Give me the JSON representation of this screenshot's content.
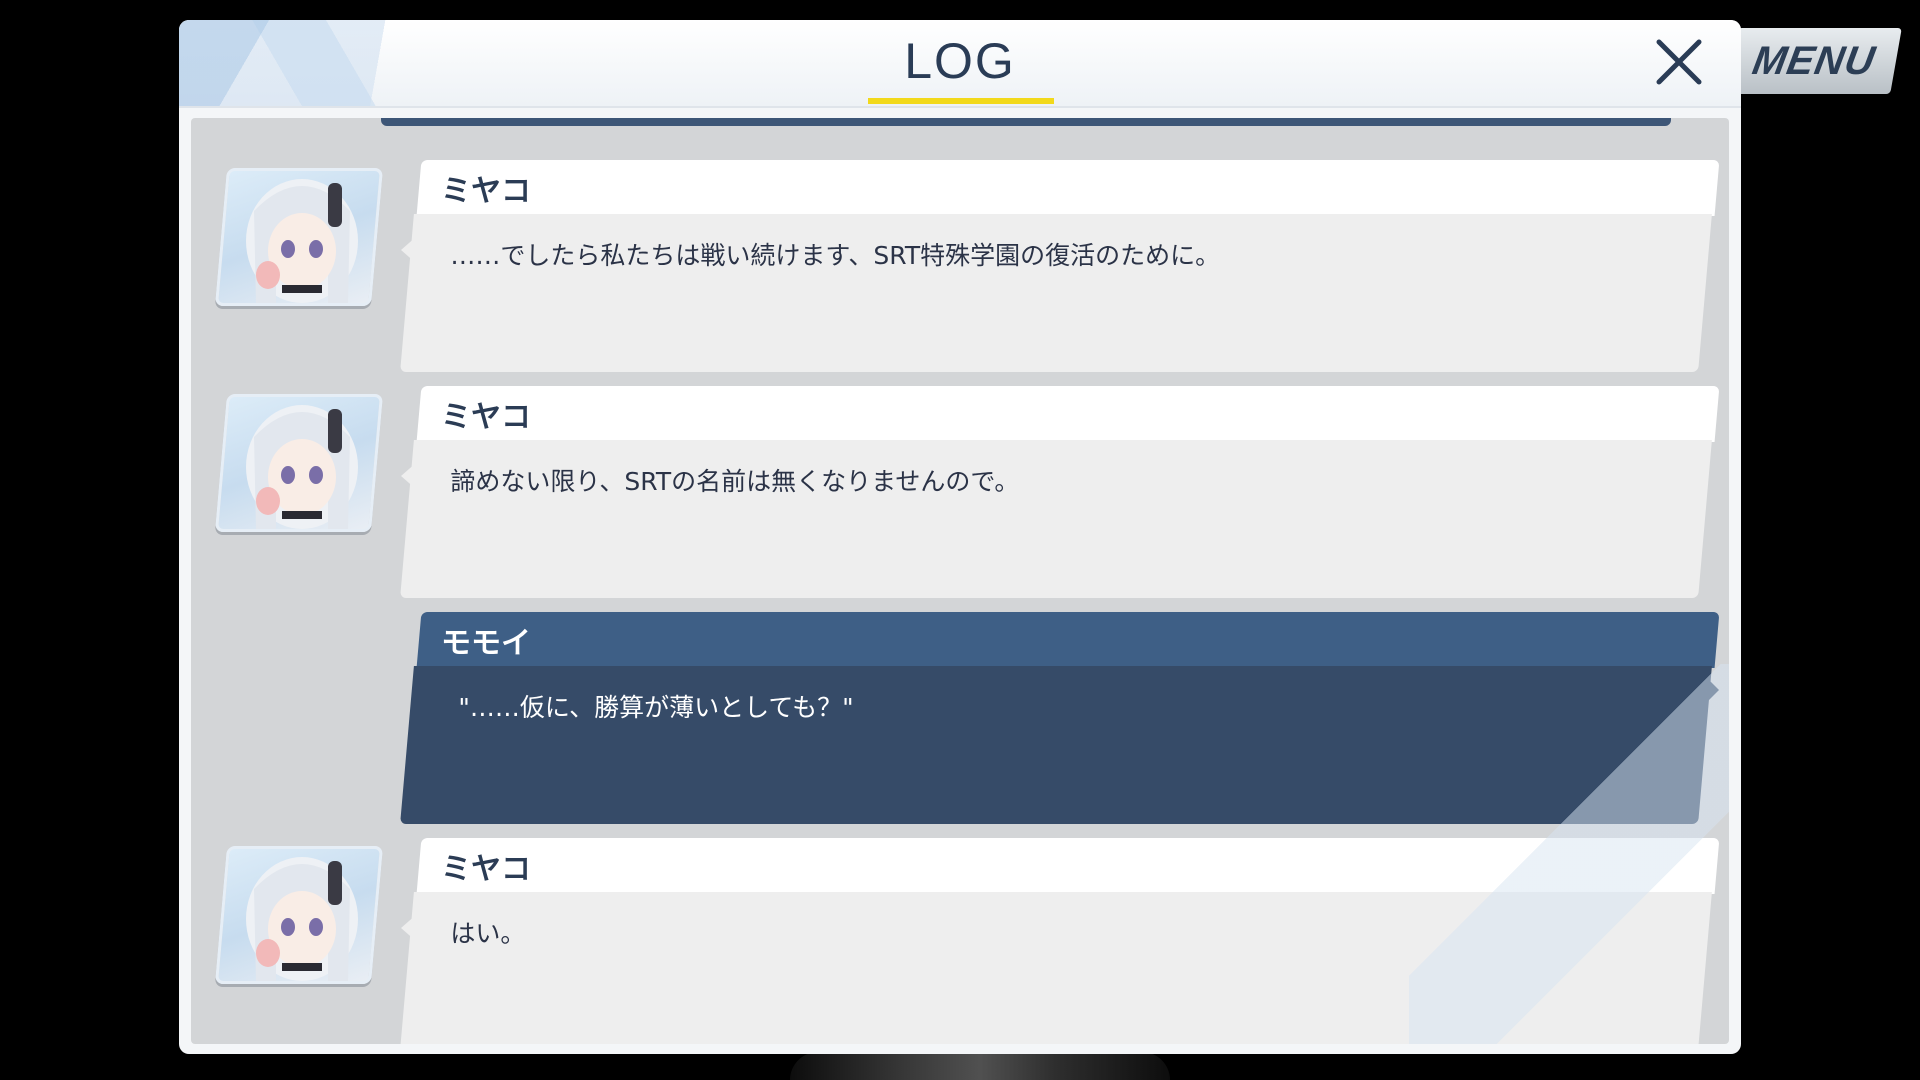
{
  "window": {
    "title": "LOG",
    "close_icon": "close-icon"
  },
  "menu": {
    "label": "MENU"
  },
  "colors": {
    "accent": "#f2d91b",
    "title": "#2a3c56",
    "self_header": "#3e5f86",
    "self_body": "#364b68"
  },
  "entries": [
    {
      "speaker": "ミヤコ",
      "text": "……でしたら私たちは戦い続けます、SRT特殊学園の復活のために。"
    },
    {
      "speaker": "ミヤコ",
      "text": "諦めない限り、SRTの名前は無くなりませんので。"
    },
    {
      "speaker": "モモイ",
      "text": "\"……仮に、勝算が薄いとしても？\""
    },
    {
      "speaker": "ミヤコ",
      "text": "はい。"
    }
  ]
}
